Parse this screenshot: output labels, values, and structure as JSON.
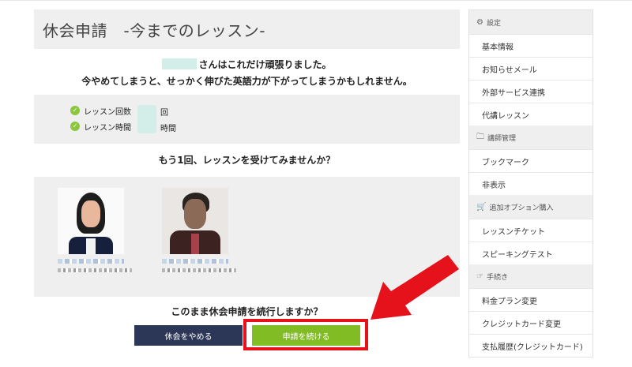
{
  "main": {
    "title": "休会申請　-今までのレッスン-",
    "message_line1_suffix": "さんはこれだけ頑張りました。",
    "message_line2": "今やめてしまうと、せっかく伸びた英語力が下がってしまうかもしれません。",
    "stats": [
      {
        "label": "レッスン回数",
        "unit": "回"
      },
      {
        "label": "レッスン時間",
        "unit": "時間"
      }
    ],
    "question": "もう1回、レッスンを受けてみませんか？",
    "confirm": "このまま休会申請を続行しますか？",
    "stop_label": "休会をやめる",
    "continue_label": "申請を続ける"
  },
  "sidebar": {
    "sections": [
      {
        "heading": "設定",
        "icon": "gear-icon",
        "items": [
          "基本情報",
          "お知らせメール",
          "外部サービス連携",
          "代講レッスン"
        ]
      },
      {
        "heading": "講師管理",
        "icon": "folder-icon",
        "items": [
          "ブックマーク",
          "非表示"
        ]
      },
      {
        "heading": "追加オプション購入",
        "icon": "cart-icon",
        "items": [
          "レッスンチケット",
          "スピーキングテスト"
        ]
      },
      {
        "heading": "手続き",
        "icon": "hand-pointer-icon",
        "items": [
          "料金プラン変更",
          "クレジットカード変更",
          "支払履歴(クレジットカード)"
        ]
      }
    ]
  },
  "colors": {
    "continue_button": "#82bc24",
    "stop_button": "#2c3656",
    "highlight": "#e6121b",
    "check": "#8cc63f",
    "panel_bg": "#efefef"
  }
}
